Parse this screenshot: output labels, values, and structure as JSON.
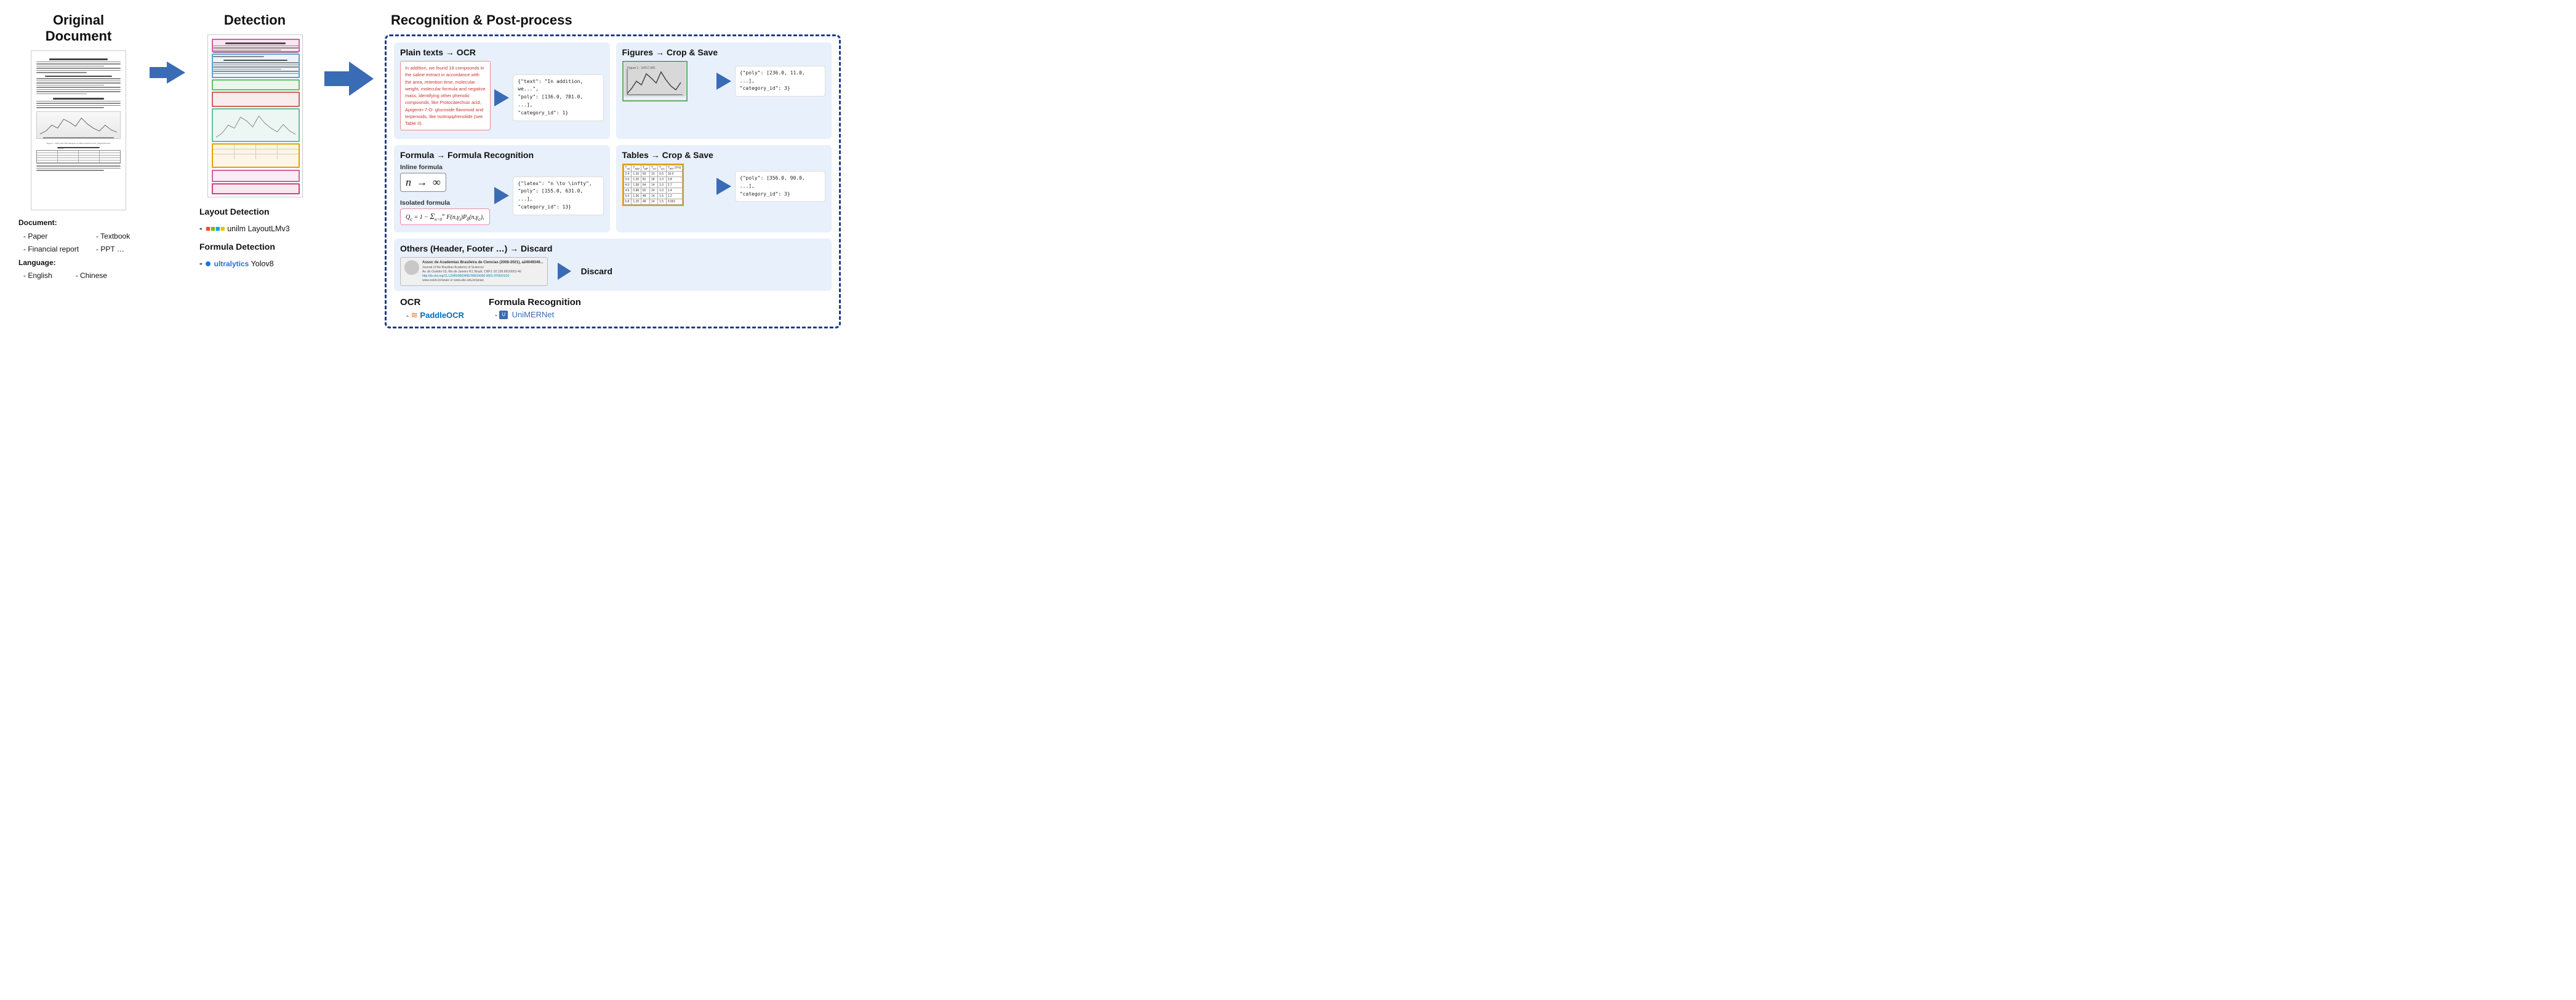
{
  "sections": {
    "original_doc": {
      "title": "Original Document",
      "meta": {
        "document_label": "Document:",
        "items_col1": [
          "- Paper",
          "- Financial report"
        ],
        "items_col2": [
          "- Textbook",
          "- PPT  …"
        ],
        "language_label": "Language:",
        "lang_col1": [
          "- English"
        ],
        "lang_col2": [
          "- Chinese"
        ]
      }
    },
    "detection": {
      "title": "Detection",
      "meta_layout": {
        "label": "Layout Detection",
        "bullet": "-",
        "logo_name": "unilm",
        "product": "LayoutLMv3"
      },
      "meta_formula": {
        "label": "Formula Detection",
        "bullet": "-",
        "product": "Yolov8"
      }
    },
    "recognition": {
      "title": "Recognition & Post-process",
      "plain_texts": {
        "section_title": "Plain texts → OCR",
        "sample_text": "In addition, we found 18 compounds in the saline extract in accordance with the area, retention time, molecular weight, molecular formula and negative mass, identifying other phenolic compounds, like Protocatechuic acid, Apigenin-7-O- glucoside flavonoid and terpenoids, like Isotropiphenolide (see Table II).",
        "json_output": "{\"text\": \"In addition, we...\",\n\"poly\": [136.0, 781.0, ...],\n\"category_id\": 1}"
      },
      "figures": {
        "section_title": "Figures → Crop & Save",
        "json_output": "{\"poly\": [236.0, 11.0, ...],\n\"category_id\": 3}"
      },
      "formula": {
        "section_title": "Formula → Formula Recognition",
        "inline_label": "Inline formula",
        "inline_math": "n → ∞",
        "isolated_label": "Isolated formula",
        "isolated_math": "Q_c = 1 - Σ F(n,γ_i) P_0(n, γ_c)",
        "json_output": "{\"latex\": \"n \\\\to \\\\infty\",\n\"poly\": [155.0, 631.0, ...],\n\"category_id\": 13}"
      },
      "tables": {
        "section_title": "Tables → Crop & Save",
        "json_output": "{\"poly\": [356.0, 90.0, ...],\n\"category_id\": 3}"
      },
      "others": {
        "section_title": "Others (Header, Footer …) → Discard",
        "discard_label": "Discard"
      },
      "ocr": {
        "title": "OCR",
        "item": "- PaddleOCR"
      },
      "formula_recog": {
        "title": "Formula Recognition",
        "item": "- UniMERNet"
      }
    }
  }
}
